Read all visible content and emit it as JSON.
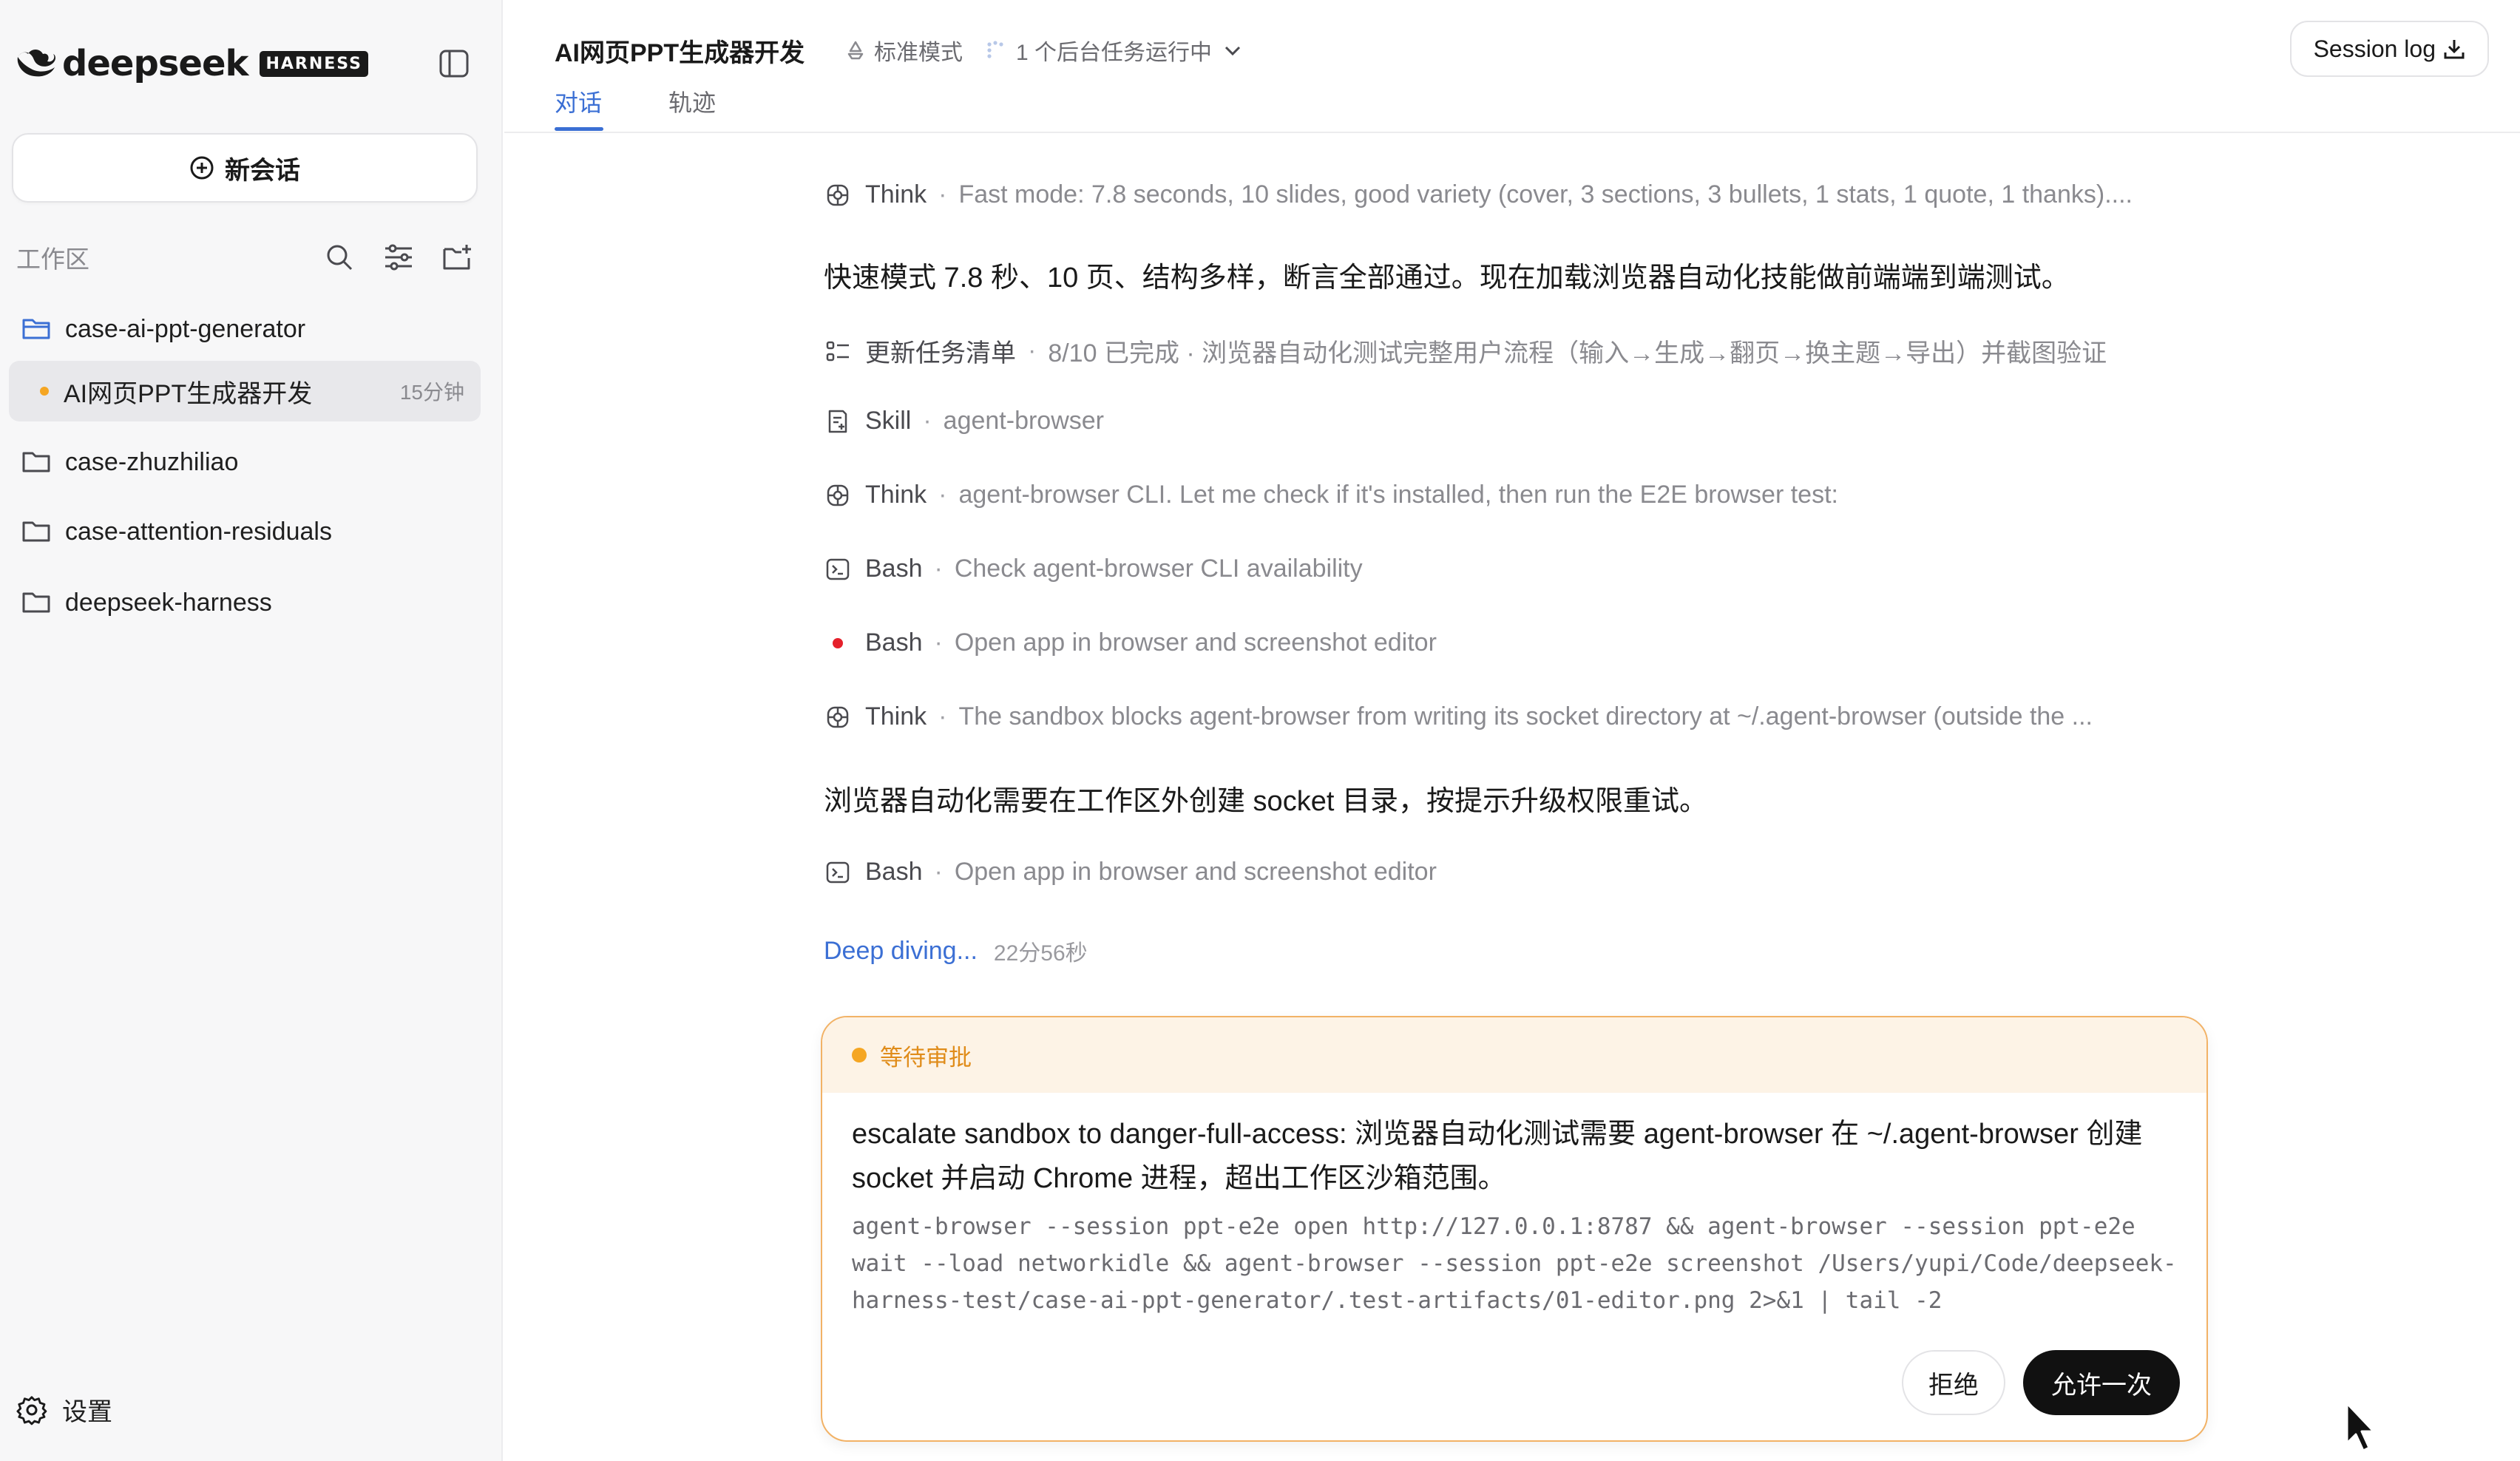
{
  "sidebar": {
    "brand": {
      "name": "deepseek",
      "badge": "HARNESS"
    },
    "new_chat_label": "新会话",
    "workspace_label": "工作区",
    "items": [
      {
        "label": "case-ai-ppt-generator",
        "type": "folder-open"
      },
      {
        "label": "AI网页PPT生成器开发",
        "type": "session",
        "time": "15分钟",
        "active": true
      },
      {
        "label": "case-zhuzhiliao",
        "type": "folder"
      },
      {
        "label": "case-attention-residuals",
        "type": "folder"
      },
      {
        "label": "deepseek-harness",
        "type": "folder"
      }
    ],
    "settings_label": "设置"
  },
  "header": {
    "title": "AI网页PPT生成器开发",
    "mode": "标准模式",
    "tasks": "1 个后台任务运行中",
    "tabs": [
      {
        "label": "对话",
        "active": true
      },
      {
        "label": "轨迹",
        "active": false
      }
    ],
    "session_log_label": "Session log"
  },
  "timeline": {
    "think1": {
      "name": "Think",
      "desc": "Fast mode: 7.8 seconds, 10 slides, good variety (cover, 3 sections, 3 bullets, 1 stats, 1 quote, 1 thanks)...."
    },
    "text1": "快速模式 7.8 秒、10 页、结构多样，断言全部通过。现在加载浏览器自动化技能做前端端到端测试。",
    "tasks": {
      "name": "更新任务清单",
      "desc": "8/10 已完成 · 浏览器自动化测试完整用户流程（输入→生成→翻页→换主题→导出）并截图验证"
    },
    "skill": {
      "name": "Skill",
      "desc": "agent-browser"
    },
    "think2": {
      "name": "Think",
      "desc": "agent-browser CLI. Let me check if it's installed, then run the E2E browser test:"
    },
    "bash1": {
      "name": "Bash",
      "desc": "Check agent-browser CLI availability"
    },
    "bash2": {
      "name": "Bash",
      "desc": "Open app in browser and screenshot editor"
    },
    "think3": {
      "name": "Think",
      "desc": "The sandbox blocks agent-browser from writing its socket directory at ~/.agent-browser (outside the ..."
    },
    "text2": "浏览器自动化需要在工作区外创建 socket 目录，按提示升级权限重试。",
    "bash3": {
      "name": "Bash",
      "desc": "Open app in browser and screenshot editor"
    },
    "deep_diving": "Deep diving...",
    "elapsed": "22分56秒"
  },
  "approval": {
    "status": "等待审批",
    "message": "escalate sandbox to danger-full-access: 浏览器自动化测试需要 agent-browser 在 ~/.agent-browser 创建 socket 并启动 Chrome 进程，超出工作区沙箱范围。",
    "command": "agent-browser --session ppt-e2e open http://127.0.0.1:8787 && agent-browser --session ppt-e2e wait --load networkidle && agent-browser --session ppt-e2e screenshot /Users/yupi/Code/deepseek-harness-test/case-ai-ppt-generator/.test-artifacts/01-editor.png 2>&1 | tail -2",
    "reject_label": "拒绝",
    "allow_label": "允许一次"
  },
  "colors": {
    "accent": "#3b6fd4",
    "pending": "#f5a623",
    "error_dot": "#e5202b"
  }
}
